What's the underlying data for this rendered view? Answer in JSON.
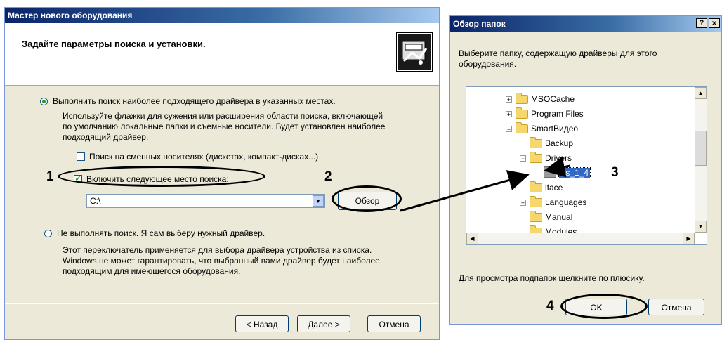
{
  "wizard": {
    "title": "Мастер нового оборудования",
    "header": "Задайте параметры поиска и установки.",
    "radio_search_label": "Выполнить поиск наиболее подходящего драйвера в указанных местах.",
    "search_description": [
      "Используйте флажки для сужения или расширения области поиска, включающей",
      "по умолчанию локальные папки и съемные носители. Будет установлен наиболее",
      "подходящий драйвер."
    ],
    "check_removable_label": "Поиск на сменных носителях (дискетах, компакт-дисках...)",
    "check_include_label": "Включить следующее место поиска:",
    "path_value": "C:\\",
    "browse_label": "Обзор",
    "radio_nosearch_label": "Не выполнять поиск. Я сам выберу нужный драйвер.",
    "nosearch_description": [
      "Этот переключатель применяется для выбора драйвера устройства из списка.",
      "Windows не может гарантировать, что выбранный вами драйвер будет наиболее",
      "подходящим для имеющегося оборудования."
    ],
    "back_label": "< Назад",
    "next_label": "Далее >",
    "cancel_label": "Отмена"
  },
  "browse_dialog": {
    "title": "Обзор папок",
    "help_button": "?",
    "close_button": "×",
    "instruction": [
      "Выберите папку, содержащую драйверы для этого",
      "оборудования."
    ],
    "tree": [
      {
        "label": "MSOCache",
        "expander": "+"
      },
      {
        "label": "Program Files",
        "expander": "+"
      },
      {
        "label": "SmartВидео",
        "expander": "−"
      },
      {
        "label": "Backup",
        "expander": ""
      },
      {
        "label": "Drivers",
        "expander": "−"
      },
      {
        "label": "Fs_1_4",
        "expander": ""
      },
      {
        "label": "iface",
        "expander": ""
      },
      {
        "label": "Languages",
        "expander": "+"
      },
      {
        "label": "Manual",
        "expander": ""
      },
      {
        "label": "Modules",
        "expander": ""
      }
    ],
    "hint": "Для просмотра подпапок щелкните по плюсику.",
    "ok_label": "OK",
    "cancel_label": "Отмена"
  },
  "annotations": {
    "n1": "1",
    "n2": "2",
    "n3": "3",
    "n4": "4"
  }
}
